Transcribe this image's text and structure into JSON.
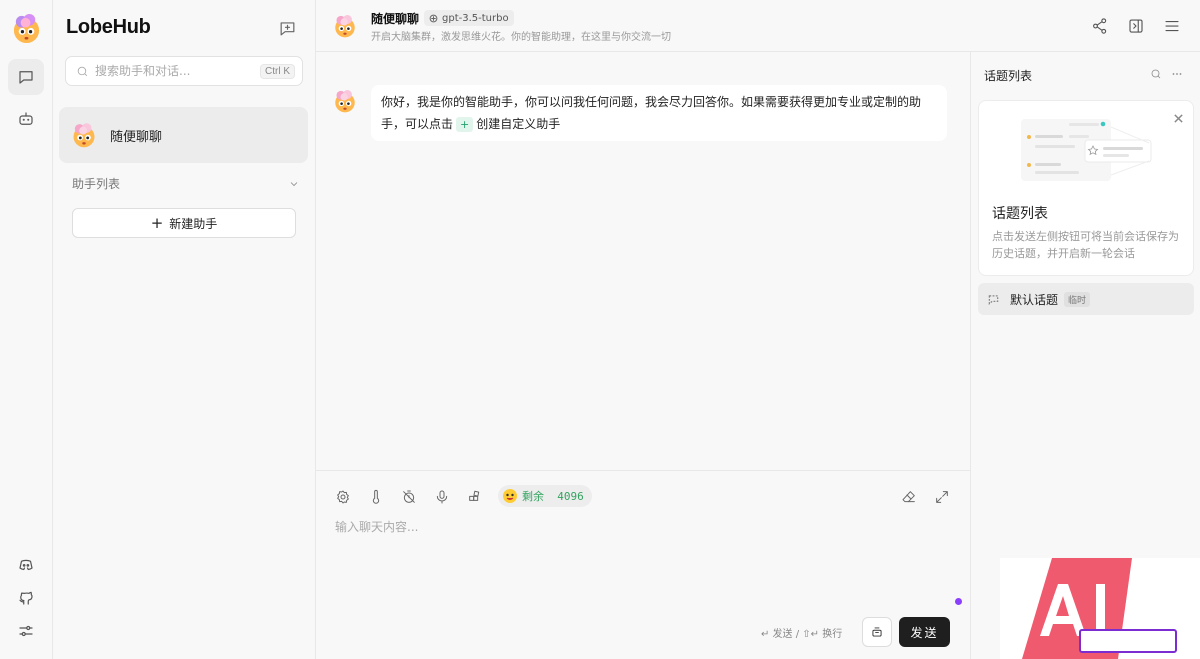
{
  "app": {
    "name": "LobeHub"
  },
  "sidebar": {
    "search_placeholder": "搜索助手和对话...",
    "search_shortcut": "Ctrl K",
    "sessions": [
      {
        "title": "随便聊聊"
      }
    ],
    "group_label": "助手列表",
    "new_agent_label": "新建助手"
  },
  "header": {
    "title": "随便聊聊",
    "model": "gpt-3.5-turbo",
    "description": "开启大脑集群，激发思维火花。你的智能助理，在这里与你交流一切"
  },
  "message": {
    "text_before": "你好，我是你的智能助手，你可以问我任何问题，我会尽力回答你。如果需要获得更加专业或定制的助手，可以点击",
    "chip": "+",
    "text_after": "创建自定义助手"
  },
  "input": {
    "tokens_label": "剩余",
    "tokens_value": "4096",
    "placeholder": "输入聊天内容...",
    "hint": "↵ 发送 / ⇧↵ 换行",
    "send_label": "发送"
  },
  "topics": {
    "title": "话题列表",
    "card_title": "话题列表",
    "card_desc": "点击发送左侧按钮可将当前会话保存为历史话题，并开启新一轮会话",
    "items": [
      {
        "name": "默认话题",
        "tag": "临时"
      }
    ]
  },
  "icons": [
    "chat-icon",
    "robot-icon",
    "discord-icon",
    "github-icon",
    "settings-icon",
    "new-chat-icon",
    "search-icon",
    "chevron-down-icon",
    "share-icon",
    "panel-icon",
    "menu-icon",
    "model-icon",
    "settings-gear-icon",
    "temperature-icon",
    "timer-icon",
    "mic-icon",
    "plugins-icon",
    "eraser-icon",
    "expand-icon",
    "save-topic-icon",
    "close-icon",
    "more-icon"
  ],
  "colors": {
    "accent": "#1f1f1f",
    "token_green": "#33a35f",
    "dot_purple": "#8a3ffc",
    "chip_green": "#22a06b"
  }
}
